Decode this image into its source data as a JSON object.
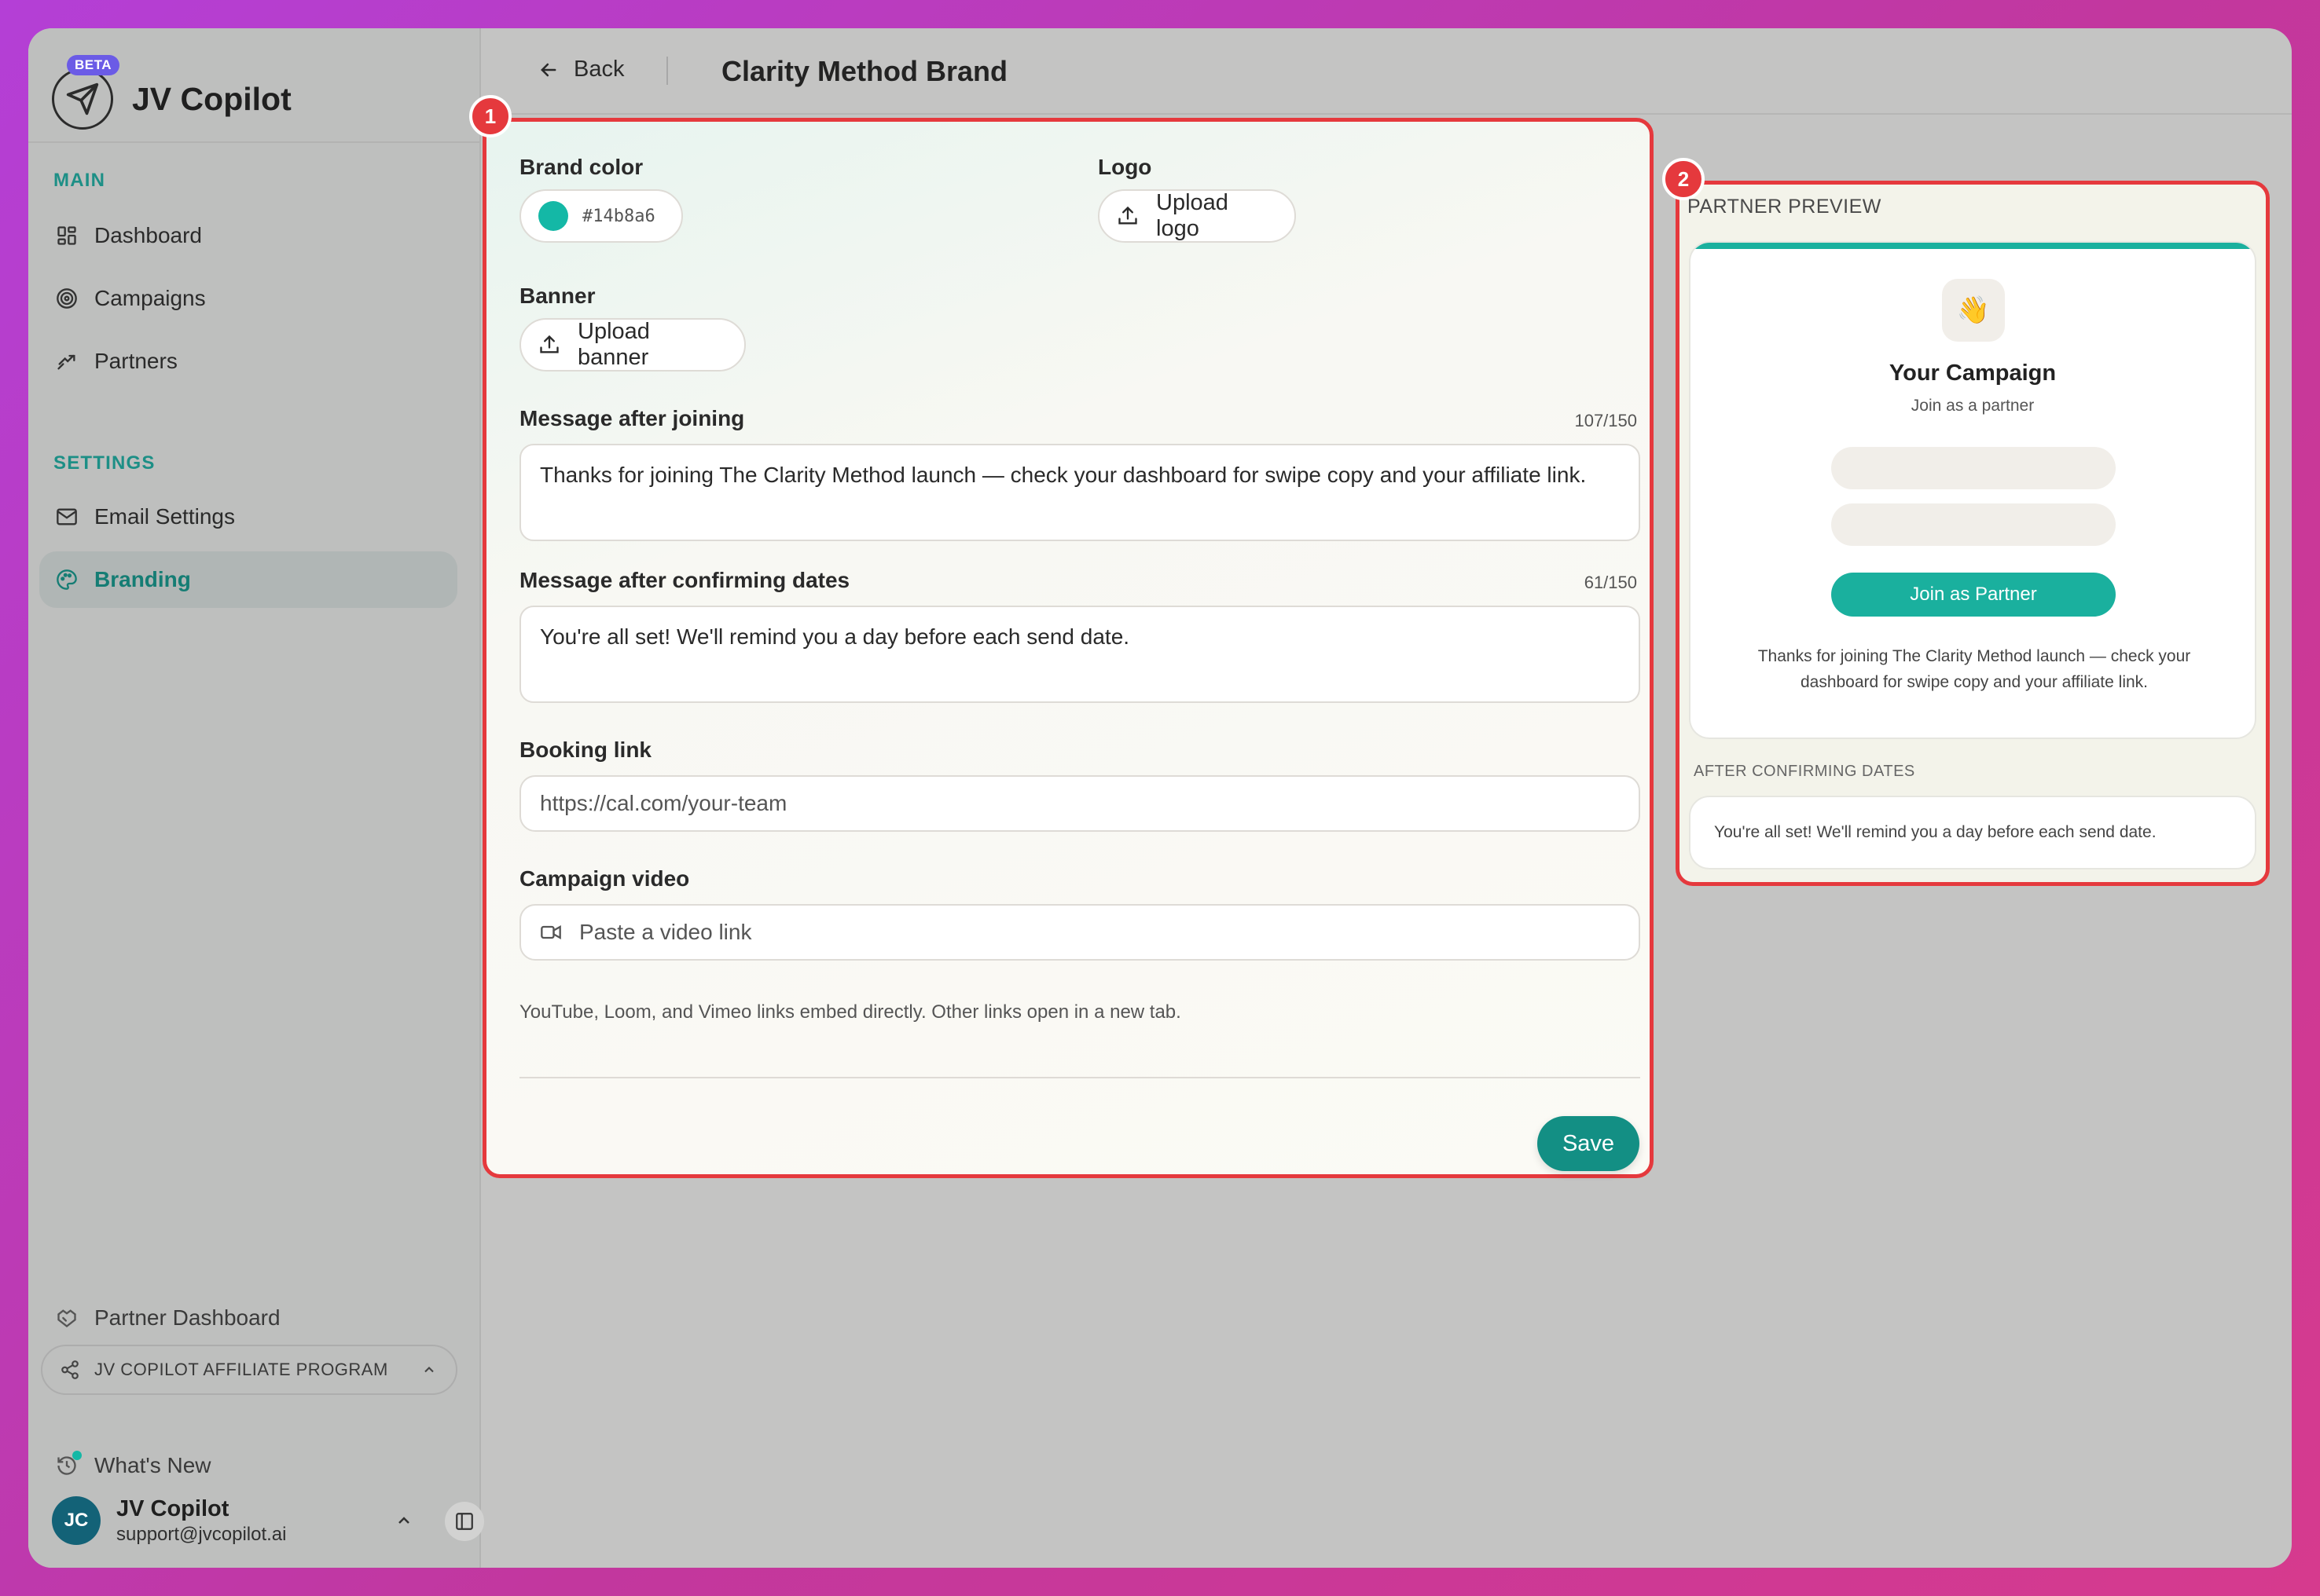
{
  "app": {
    "name": "JV Copilot",
    "badge": "BETA"
  },
  "sidebar": {
    "main_label": "MAIN",
    "main_items": [
      {
        "label": "Dashboard",
        "icon": "dashboard-icon"
      },
      {
        "label": "Campaigns",
        "icon": "target-icon"
      },
      {
        "label": "Partners",
        "icon": "handshake-icon"
      }
    ],
    "settings_label": "SETTINGS",
    "settings_items": [
      {
        "label": "Email Settings",
        "icon": "mail-icon"
      },
      {
        "label": "Branding",
        "icon": "palette-icon",
        "active": true
      }
    ],
    "partner_dashboard": "Partner Dashboard",
    "affiliate_program": "JV COPILOT AFFILIATE PROGRAM",
    "whats_new": "What's New",
    "user": {
      "initials": "JC",
      "name": "JV Copilot",
      "email": "support@jvcopilot.ai"
    }
  },
  "header": {
    "back_label": "Back",
    "title": "Clarity Method Brand"
  },
  "form": {
    "badge": "1",
    "brand_color": {
      "label": "Brand color",
      "value": "#14b8a6"
    },
    "logo": {
      "label": "Logo",
      "button": "Upload logo"
    },
    "banner": {
      "label": "Banner",
      "button": "Upload banner"
    },
    "message_joining": {
      "label": "Message after joining",
      "counter": "107/150",
      "value": "Thanks for joining The Clarity Method launch — check your dashboard for swipe copy and your affiliate link."
    },
    "message_confirming": {
      "label": "Message after confirming dates",
      "counter": "61/150",
      "value": "You're all set! We'll remind you a day before each send date."
    },
    "booking_link": {
      "label": "Booking link",
      "placeholder": "https://cal.com/your-team"
    },
    "campaign_video": {
      "label": "Campaign video",
      "placeholder": "Paste a video link",
      "hint": "YouTube, Loom, and Vimeo links embed directly. Other links open in a new tab."
    },
    "save_label": "Save"
  },
  "preview": {
    "badge": "2",
    "label": "PARTNER PREVIEW",
    "emoji": "👋",
    "title": "Your Campaign",
    "subtitle": "Join as a partner",
    "join_button": "Join as Partner",
    "message": "Thanks for joining The Clarity Method launch — check your dashboard for swipe copy and your affiliate link.",
    "after_label": "AFTER CONFIRMING DATES",
    "after_message": "You're all set! We'll remind you a day before each send date."
  },
  "colors": {
    "accent": "#14b8a6",
    "teal_dark": "#138f84",
    "highlight": "#e5393d",
    "avatar": "#136277"
  }
}
